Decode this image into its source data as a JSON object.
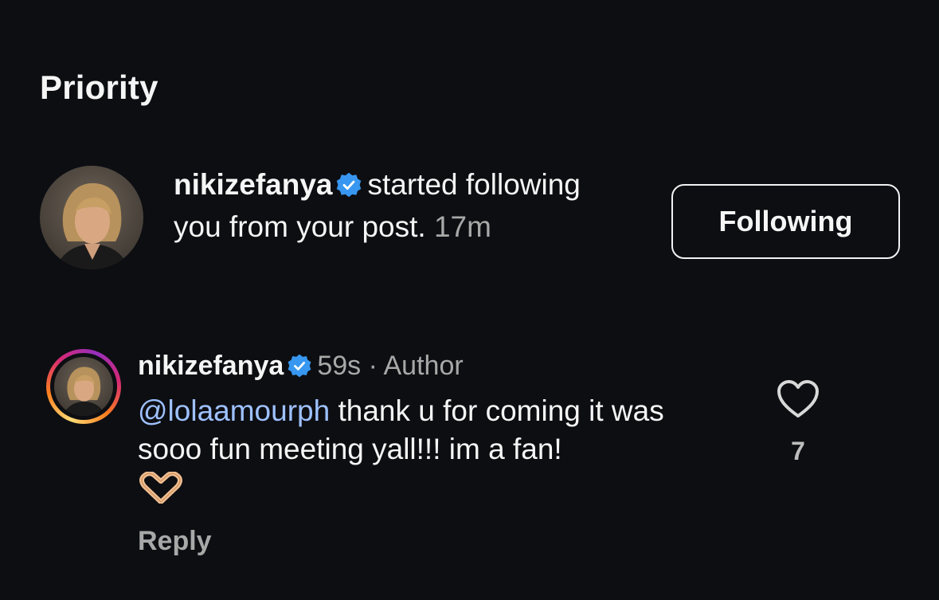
{
  "section": {
    "title": "Priority"
  },
  "notification": {
    "username": "nikizefanya",
    "message_line1": "started",
    "message_rest": "following you from your post.",
    "time": "17m",
    "button_label": "Following"
  },
  "comment": {
    "username": "nikizefanya",
    "time": "59s",
    "separator": "·",
    "role": "Author",
    "mention": "@lolaamourph",
    "text": "thank u for coming it was sooo fun meeting yall!!! im a fan!",
    "emoji": "heart-hands-emoji",
    "like_count": "7",
    "reply_label": "Reply"
  },
  "colors": {
    "background": "#0d0e12",
    "verified_badge": "#3897f0",
    "mention": "#9ec1ff",
    "muted_text": "#a8a8a8"
  },
  "icons": [
    "verified-badge-icon",
    "heart-outline-icon",
    "heart-hands-emoji",
    "story-ring"
  ]
}
